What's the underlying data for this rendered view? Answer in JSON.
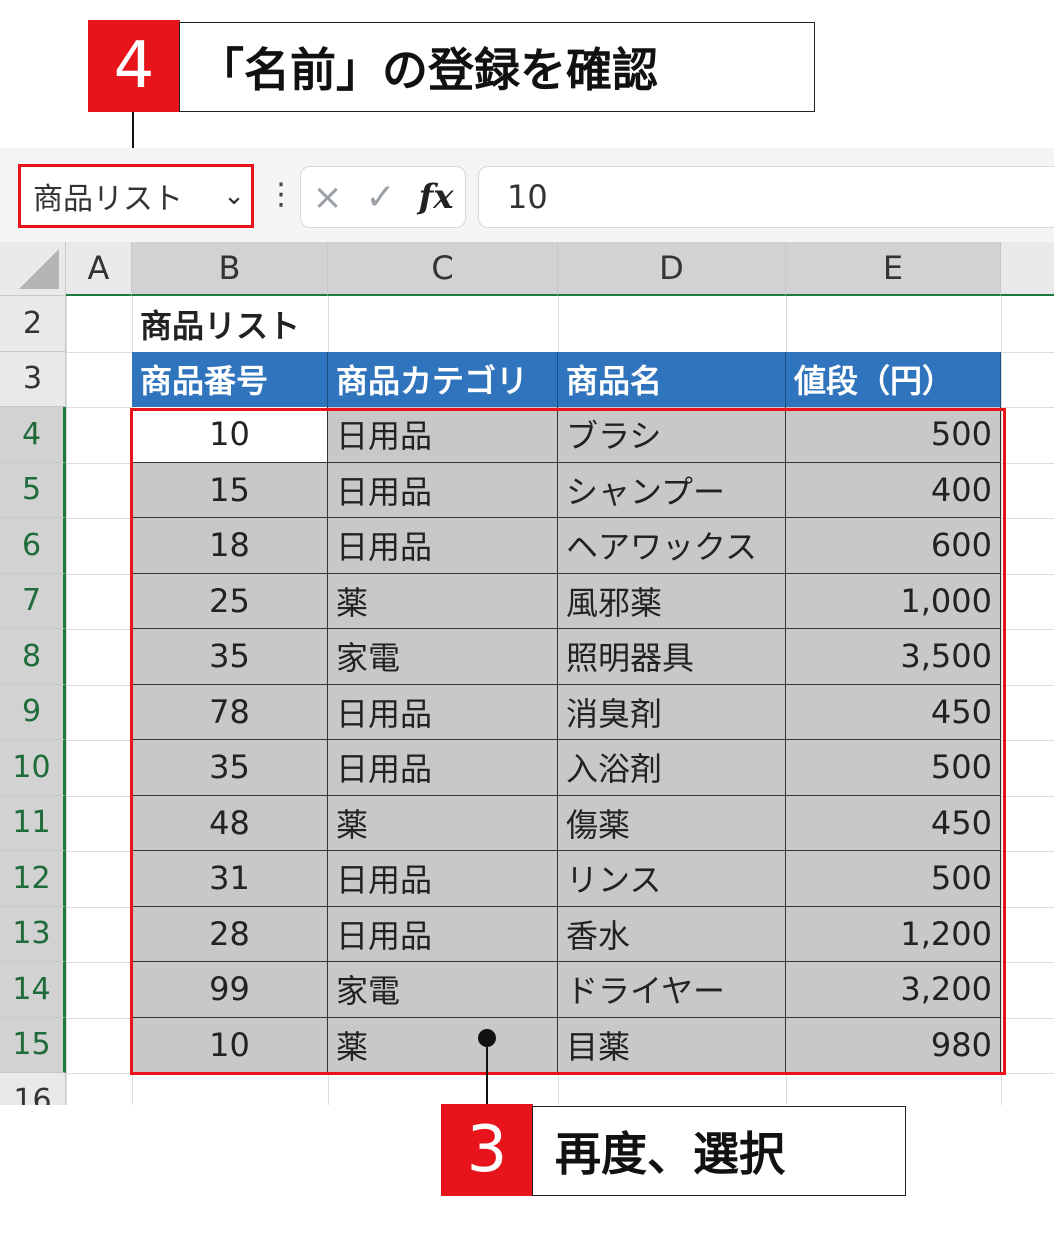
{
  "callouts": {
    "step4": {
      "number": "4",
      "text": "「名前」の登録を確認"
    },
    "step3": {
      "number": "3",
      "text": "再度、選択"
    }
  },
  "formula_bar": {
    "name_box": "商品リスト",
    "cancel_icon": "×",
    "enter_icon": "✓",
    "fx_label": "fx",
    "formula_value": "10"
  },
  "columns": [
    "A",
    "B",
    "C",
    "D",
    "E"
  ],
  "row_numbers": [
    "2",
    "3",
    "4",
    "5",
    "6",
    "7",
    "8",
    "9",
    "10",
    "11",
    "12",
    "13",
    "14",
    "15",
    "16"
  ],
  "table": {
    "title": "商品リスト",
    "headers": [
      "商品番号",
      "商品カテゴリ",
      "商品名",
      "値段（円）"
    ],
    "rows": [
      [
        "10",
        "日用品",
        "ブラシ",
        "500"
      ],
      [
        "15",
        "日用品",
        "シャンプー",
        "400"
      ],
      [
        "18",
        "日用品",
        "ヘアワックス",
        "600"
      ],
      [
        "25",
        "薬",
        "風邪薬",
        "1,000"
      ],
      [
        "35",
        "家電",
        "照明器具",
        "3,500"
      ],
      [
        "78",
        "日用品",
        "消臭剤",
        "450"
      ],
      [
        "35",
        "日用品",
        "入浴剤",
        "500"
      ],
      [
        "48",
        "薬",
        "傷薬",
        "450"
      ],
      [
        "31",
        "日用品",
        "リンス",
        "500"
      ],
      [
        "28",
        "日用品",
        "香水",
        "1,200"
      ],
      [
        "99",
        "家電",
        "ドライヤー",
        "3,200"
      ],
      [
        "10",
        "薬",
        "目薬",
        "980"
      ]
    ]
  },
  "colors": {
    "accent_red": "#e8141b",
    "header_blue": "#2f74bd",
    "selection_gray": "#c8c8c8",
    "excel_green": "#1f7a3f"
  }
}
